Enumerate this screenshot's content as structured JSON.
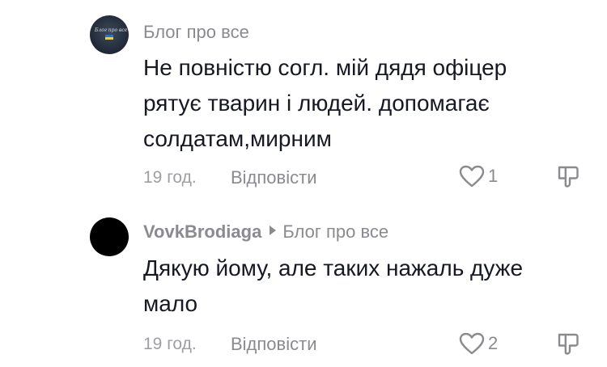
{
  "comments": [
    {
      "author": "Блог про все",
      "avatar": {
        "logo_text": "Блог про все",
        "flag_colors": [
          "#2d6fd6",
          "#f3cf2a"
        ]
      },
      "lines": [
        "Не повністю согл. мій дядя офіцер",
        "рятує тварин і людей. допомагає",
        "солдатам,мирним"
      ],
      "time": "19 год.",
      "reply_label": "Відповісти",
      "likes": "1",
      "like_icon": "heart-outline-icon",
      "dislike_icon": "thumbs-down-icon"
    },
    {
      "author": "VovkBrodiaga",
      "reply_to": "Блог про все",
      "lines": [
        "Дякую йому, але таких нажаль дуже",
        "мало"
      ],
      "time": "19 год.",
      "reply_label": "Відповісти",
      "likes": "2",
      "like_icon": "heart-outline-icon",
      "dislike_icon": "thumbs-down-icon"
    }
  ]
}
